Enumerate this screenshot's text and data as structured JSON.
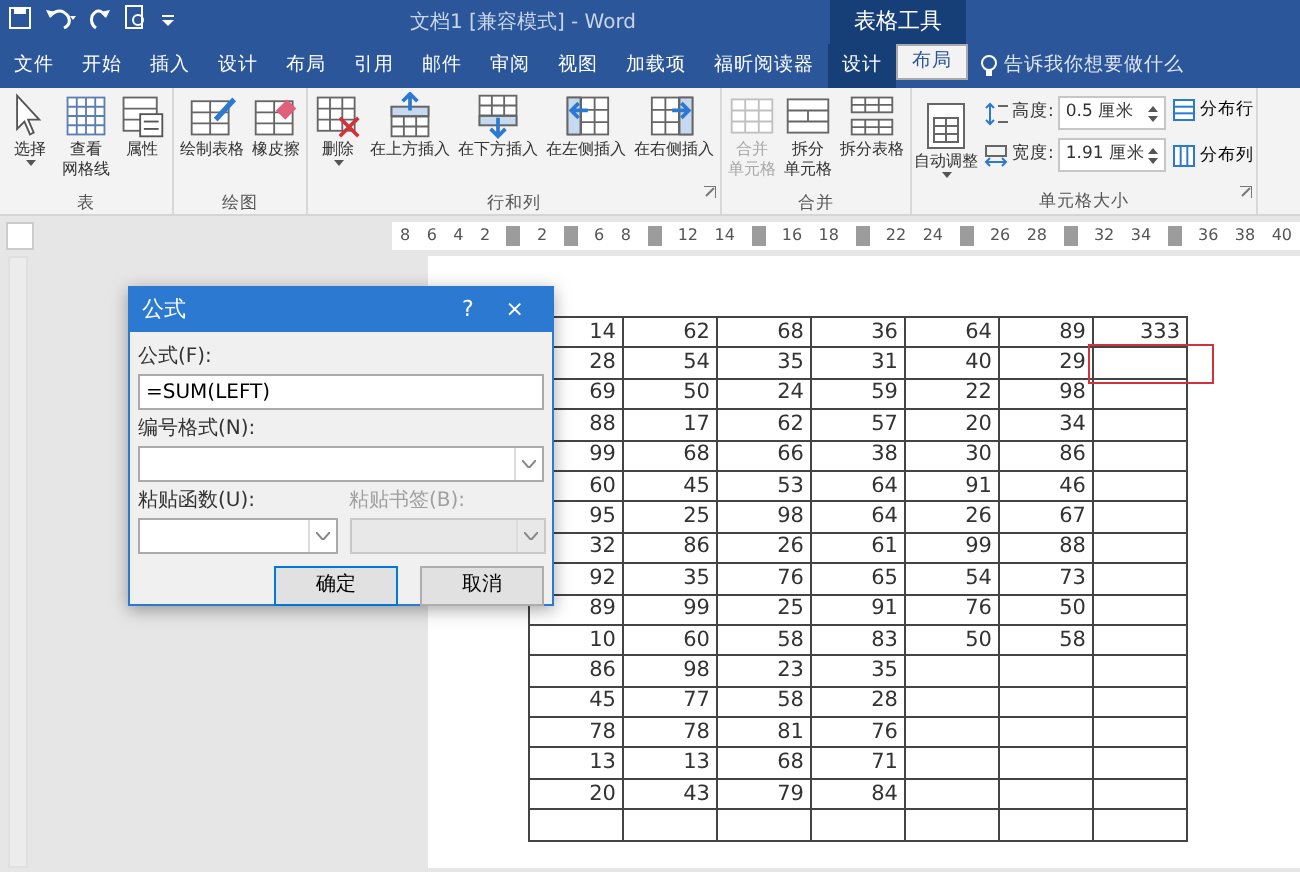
{
  "window": {
    "title": "文档1 [兼容模式] - Word",
    "context_title": "表格工具"
  },
  "tabs": [
    {
      "label": "文件",
      "selected": false,
      "context": false
    },
    {
      "label": "开始",
      "selected": false,
      "context": false
    },
    {
      "label": "插入",
      "selected": false,
      "context": false
    },
    {
      "label": "设计",
      "selected": false,
      "context": false
    },
    {
      "label": "布局",
      "selected": false,
      "context": false
    },
    {
      "label": "引用",
      "selected": false,
      "context": false
    },
    {
      "label": "邮件",
      "selected": false,
      "context": false
    },
    {
      "label": "审阅",
      "selected": false,
      "context": false
    },
    {
      "label": "视图",
      "selected": false,
      "context": false
    },
    {
      "label": "加载项",
      "selected": false,
      "context": false
    },
    {
      "label": "福昕阅读器",
      "selected": false,
      "context": false
    },
    {
      "label": "设计",
      "selected": false,
      "context": true
    },
    {
      "label": "布局",
      "selected": true,
      "context": true
    }
  ],
  "tell_me": {
    "placeholder": "告诉我你想要做什么"
  },
  "ribbon_groups": [
    {
      "label": "表",
      "kind": "buttons",
      "launcher": false,
      "buttons": [
        {
          "label": "选择",
          "kind": "select",
          "dropdown": true,
          "disabled": false
        },
        {
          "lines": [
            "查看",
            "网格线"
          ],
          "kind": "gridlines",
          "dropdown": false,
          "disabled": false
        },
        {
          "label": "属性",
          "kind": "properties",
          "dropdown": false,
          "disabled": false
        }
      ]
    },
    {
      "label": "绘图",
      "kind": "buttons",
      "launcher": false,
      "buttons": [
        {
          "label": "绘制表格",
          "kind": "draw",
          "dropdown": false,
          "disabled": false
        },
        {
          "label": "橡皮擦",
          "kind": "eraser",
          "dropdown": false,
          "disabled": false
        }
      ]
    },
    {
      "label": "行和列",
      "kind": "buttons",
      "launcher": true,
      "buttons": [
        {
          "label": "删除",
          "kind": "delete",
          "dropdown": true,
          "disabled": false
        },
        {
          "label": "在上方插入",
          "kind": "above",
          "dropdown": false,
          "disabled": false
        },
        {
          "label": "在下方插入",
          "kind": "below",
          "dropdown": false,
          "disabled": false
        },
        {
          "label": "在左侧插入",
          "kind": "left",
          "dropdown": false,
          "disabled": false
        },
        {
          "label": "在右侧插入",
          "kind": "right",
          "dropdown": false,
          "disabled": false
        }
      ]
    },
    {
      "label": "合并",
      "kind": "buttons",
      "launcher": false,
      "buttons": [
        {
          "lines": [
            "合并",
            "单元格"
          ],
          "kind": "merge",
          "dropdown": false,
          "disabled": true
        },
        {
          "lines": [
            "拆分",
            "单元格"
          ],
          "kind": "split",
          "dropdown": false,
          "disabled": false
        },
        {
          "label": "拆分表格",
          "kind": "splittable",
          "dropdown": false,
          "disabled": false
        }
      ]
    },
    {
      "label": "单元格大小",
      "kind": "cellsize",
      "launcher": true,
      "autofit": {
        "label": "自动调整",
        "dropdown": true
      },
      "fields": [
        {
          "label": "高度:",
          "value": "0.5 厘米",
          "kind": "height"
        },
        {
          "label": "宽度:",
          "value": "1.91 厘米",
          "kind": "width"
        }
      ],
      "distribute": [
        {
          "label": "分布行",
          "kind": "rows"
        },
        {
          "label": "分布列",
          "kind": "cols"
        }
      ]
    }
  ],
  "ruler": [
    {
      "kind": "num",
      "label": "8"
    },
    {
      "kind": "num",
      "label": "6"
    },
    {
      "kind": "num",
      "label": "4"
    },
    {
      "kind": "num",
      "label": "2"
    },
    {
      "kind": "mark"
    },
    {
      "kind": "num",
      "label": "2"
    },
    {
      "kind": "mark"
    },
    {
      "kind": "num",
      "label": "6"
    },
    {
      "kind": "num",
      "label": "8"
    },
    {
      "kind": "mark"
    },
    {
      "kind": "num",
      "label": "12"
    },
    {
      "kind": "num",
      "label": "14"
    },
    {
      "kind": "mark"
    },
    {
      "kind": "num",
      "label": "16"
    },
    {
      "kind": "num",
      "label": "18"
    },
    {
      "kind": "mark"
    },
    {
      "kind": "num",
      "label": "22"
    },
    {
      "kind": "num",
      "label": "24"
    },
    {
      "kind": "mark"
    },
    {
      "kind": "num",
      "label": "26"
    },
    {
      "kind": "num",
      "label": "28"
    },
    {
      "kind": "mark"
    },
    {
      "kind": "num",
      "label": "32"
    },
    {
      "kind": "num",
      "label": "34"
    },
    {
      "kind": "mark"
    },
    {
      "kind": "num",
      "label": "36"
    },
    {
      "kind": "num",
      "label": "38"
    },
    {
      "kind": "num",
      "label": "40"
    }
  ],
  "table": {
    "rows": [
      {
        "cells": [
          "14",
          "62",
          "68",
          "36",
          "64",
          "89",
          "333"
        ],
        "highlight_last": false
      },
      {
        "cells": [
          "28",
          "54",
          "35",
          "31",
          "40",
          "29",
          ""
        ],
        "highlight_last": true
      },
      {
        "cells": [
          "69",
          "50",
          "24",
          "59",
          "22",
          "98",
          ""
        ],
        "highlight_last": false
      },
      {
        "cells": [
          "88",
          "17",
          "62",
          "57",
          "20",
          "34",
          ""
        ],
        "highlight_last": false
      },
      {
        "cells": [
          "99",
          "68",
          "66",
          "38",
          "30",
          "86",
          ""
        ],
        "highlight_last": false
      },
      {
        "cells": [
          "60",
          "45",
          "53",
          "64",
          "91",
          "46",
          ""
        ],
        "highlight_last": false
      },
      {
        "cells": [
          "95",
          "25",
          "98",
          "64",
          "26",
          "67",
          ""
        ],
        "highlight_last": false
      },
      {
        "cells": [
          "32",
          "86",
          "26",
          "61",
          "99",
          "88",
          ""
        ],
        "highlight_last": false
      },
      {
        "cells": [
          "92",
          "35",
          "76",
          "65",
          "54",
          "73",
          ""
        ],
        "highlight_last": false
      },
      {
        "cells": [
          "89",
          "99",
          "25",
          "91",
          "76",
          "50",
          ""
        ],
        "highlight_last": false
      },
      {
        "cells": [
          "10",
          "60",
          "58",
          "83",
          "50",
          "58",
          ""
        ],
        "highlight_last": false
      },
      {
        "cells": [
          "86",
          "98",
          "23",
          "35",
          "",
          "",
          ""
        ],
        "highlight_last": false
      },
      {
        "cells": [
          "45",
          "77",
          "58",
          "28",
          "",
          "",
          ""
        ],
        "highlight_last": false
      },
      {
        "cells": [
          "78",
          "78",
          "81",
          "76",
          "",
          "",
          ""
        ],
        "highlight_last": false
      },
      {
        "cells": [
          "13",
          "13",
          "68",
          "71",
          "",
          "",
          ""
        ],
        "highlight_last": false
      },
      {
        "cells": [
          "20",
          "43",
          "79",
          "84",
          "",
          "",
          ""
        ],
        "highlight_last": false
      },
      {
        "cells": [
          "",
          "",
          "",
          "",
          "",
          "",
          ""
        ],
        "highlight_last": false
      }
    ]
  },
  "dialog": {
    "title": "公式",
    "help": "?",
    "close": "×",
    "formula_label": "公式(F):",
    "formula_value": "=SUM(LEFT)",
    "format_label": "编号格式(N):",
    "function_label": "粘贴函数(U):",
    "bookmark_label": "粘贴书签(B):",
    "bookmark_disabled": true,
    "buttons": [
      {
        "label": "确定",
        "default": true
      },
      {
        "label": "取消",
        "default": false
      }
    ]
  }
}
